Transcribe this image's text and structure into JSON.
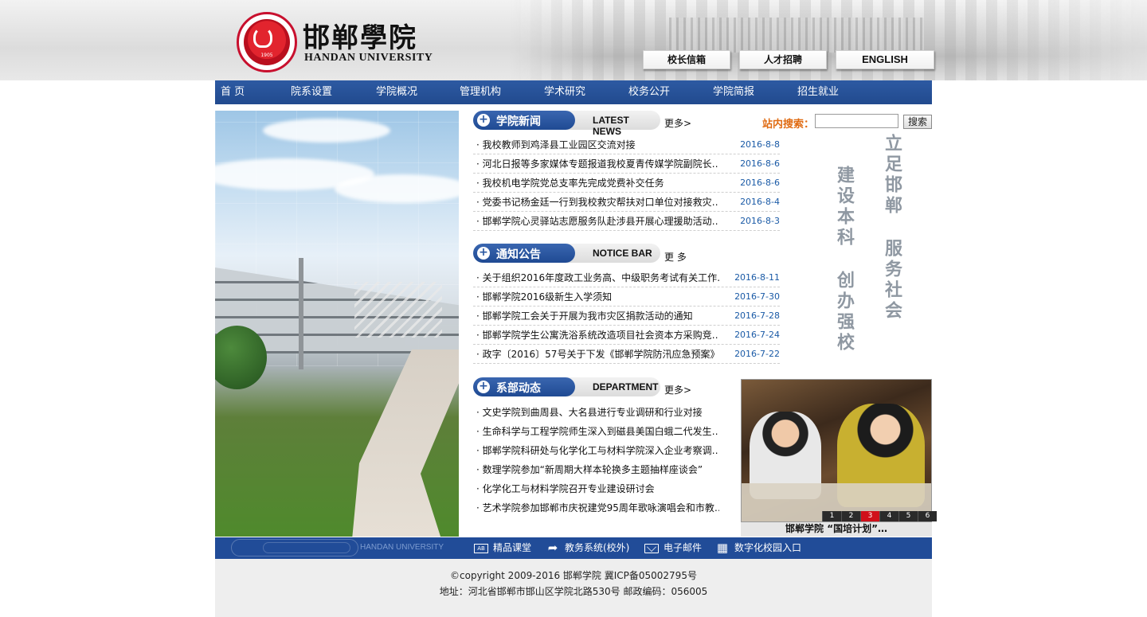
{
  "header": {
    "logo_year": "1905",
    "name_cn": "邯郸學院",
    "name_en": "HANDAN UNIVERSITY",
    "buttons": [
      "校长信箱",
      "人才招聘",
      "ENGLISH"
    ]
  },
  "nav": [
    "首 页",
    "院系设置",
    "学院概况",
    "管理机构",
    "学术研究",
    "校务公开",
    "学院简报",
    "招生就业"
  ],
  "search": {
    "label": "站内搜索：",
    "value": "",
    "button": "搜索"
  },
  "news": {
    "title_cn": "学院新闻",
    "title_en": "LATEST NEWS",
    "more": "更多>",
    "items": [
      {
        "title": "我校教师到鸡泽县工业园区交流对接",
        "date": "2016-8-8"
      },
      {
        "title": "河北日报等多家媒体专题报道我校夏青传媒学院副院长…",
        "date": "2016-8-6"
      },
      {
        "title": "我校机电学院党总支率先完成党费补交任务",
        "date": "2016-8-6"
      },
      {
        "title": "党委书记杨金廷一行到我校救灾帮扶对口单位对接救灾…",
        "date": "2016-8-4"
      },
      {
        "title": "邯郸学院心灵驿站志愿服务队赴涉县开展心理援助活动…",
        "date": "2016-8-3"
      }
    ]
  },
  "notice": {
    "title_cn": "通知公告",
    "title_en": "NOTICE BAR",
    "more": "更 多",
    "items": [
      {
        "title": "关于组织2016年度政工业务高、中级职务考试有关工作…",
        "date": "2016-8-11"
      },
      {
        "title": "邯郸学院2016级新生入学须知",
        "date": "2016-7-30"
      },
      {
        "title": "邯郸学院工会关于开展为我市灾区捐款活动的通知",
        "date": "2016-7-28"
      },
      {
        "title": "邯郸学院学生公寓洗浴系统改造项目社会资本方采购竞…",
        "date": "2016-7-24"
      },
      {
        "title": "政字〔2016〕57号关于下发《邯郸学院防汛应急预案》…",
        "date": "2016-7-22"
      }
    ]
  },
  "department": {
    "title_cn": "系部动态",
    "title_en": "DEPARTMENT",
    "more": "更多>",
    "items": [
      "文史学院到曲周县、大名县进行专业调研和行业对接",
      "生命科学与工程学院师生深入到磁县美国白蛾二代发生…",
      "邯郸学院科研处与化学化工与材料学院深入企业考察调…",
      "数理学院参加“新周期大样本轮换多主题抽样座谈会”",
      "化学化工与材料学院召开专业建设研讨会",
      "艺术学院参加邯郸市庆祝建党95周年歌咏演唱会和市教…"
    ]
  },
  "calligraphy": {
    "col1": "立足邯郸",
    "col2": "服务社会",
    "col3": "建设本科",
    "col4": "创办强校"
  },
  "slideshow": {
    "numbers": [
      "1",
      "2",
      "3",
      "4",
      "5",
      "6"
    ],
    "active_index": 3,
    "caption": "邯郸学院 “国培计划”…"
  },
  "linkbar": {
    "brand": "HANDAN UNIVERSITY",
    "links": [
      {
        "icon": "ab-icon",
        "label": "精品课堂",
        "icon_text": "AB"
      },
      {
        "icon": "arrow-icon",
        "label": "教务系统(校外)",
        "icon_text": "➦"
      },
      {
        "icon": "mail-icon",
        "label": "电子邮件",
        "icon_text": ""
      },
      {
        "icon": "grid-icon",
        "label": "数字化校园入口",
        "icon_text": "▦"
      }
    ]
  },
  "footer": {
    "line1": "©copyright 2009-2016    邯郸学院    冀ICP备05002795号",
    "line2": "地址：河北省邯郸市邯山区学院北路530号    邮政编码：056005"
  },
  "colors": {
    "nav_blue": "#214a8e",
    "date_blue": "#1a5aa6",
    "search_orange": "#e06b12",
    "active_red": "#d0101a"
  }
}
